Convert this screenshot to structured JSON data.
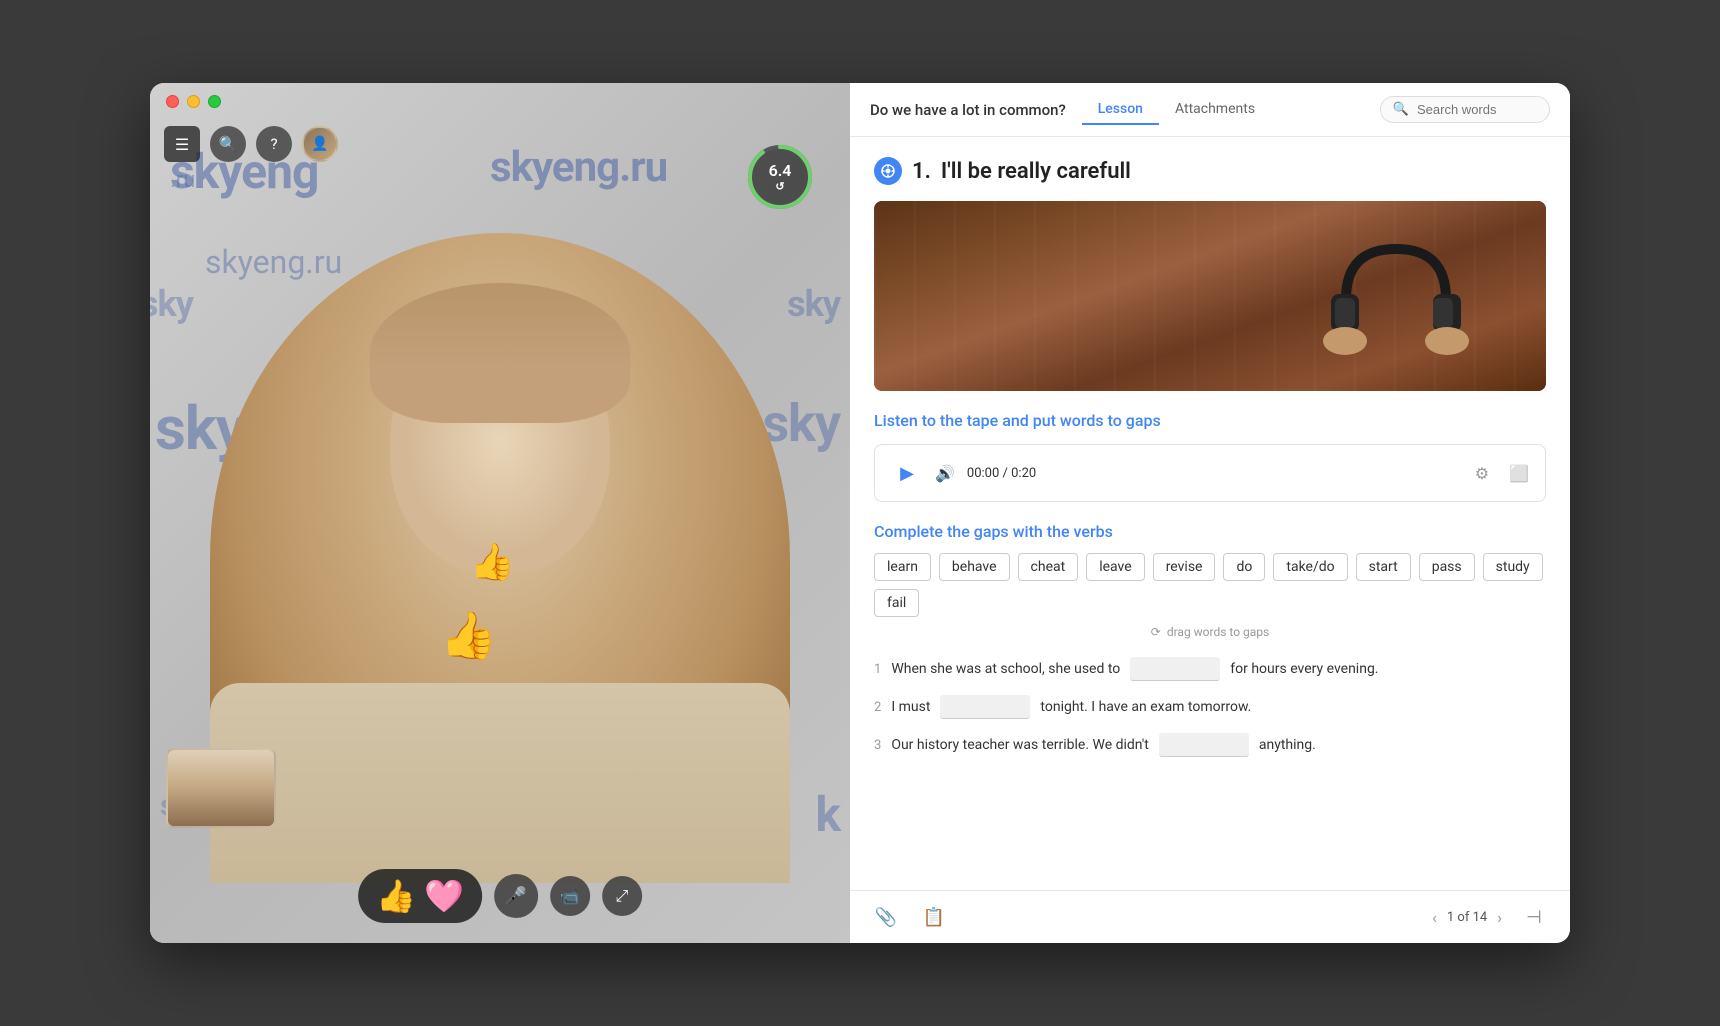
{
  "window": {
    "title": "Skyeng Lesson"
  },
  "header": {
    "lesson_name": "Do we have a lot in common?",
    "tabs": [
      {
        "label": "Lesson",
        "active": true
      },
      {
        "label": "Attachments",
        "active": false
      }
    ],
    "search_placeholder": "Search words"
  },
  "video": {
    "brand": "skyeng",
    "brand_ru": "skyeng.ru",
    "timer": "6.4",
    "timer_icon": "↺",
    "reactions": [
      "👍",
      "❤️"
    ],
    "reaction_emojis_floating": [
      "👍",
      "👍"
    ]
  },
  "lesson": {
    "section_number": "1.",
    "section_title": "I'll be really carefull",
    "instruction_1": "Listen to the tape and put words to gaps",
    "audio_time": "00:00 / 0:20",
    "verbs_title": "Complete the gaps with the verbs",
    "verbs": [
      "learn",
      "behave",
      "cheat",
      "leave",
      "revise",
      "do",
      "take/do",
      "start",
      "pass",
      "study",
      "fail"
    ],
    "drag_hint": "drag words to gaps",
    "sentences": [
      {
        "num": "1",
        "parts": [
          "When she was at school, she used to",
          "_blank_",
          "for hours every evening."
        ]
      },
      {
        "num": "2",
        "parts": [
          "I must",
          "_blank_",
          "tonight. I have an exam tomorrow."
        ]
      },
      {
        "num": "3",
        "parts": [
          "Our history teacher was terrible. We didn't",
          "_blank_",
          "anything."
        ]
      }
    ],
    "pagination": {
      "current": 1,
      "total": 14,
      "label": "1 of 14"
    }
  }
}
